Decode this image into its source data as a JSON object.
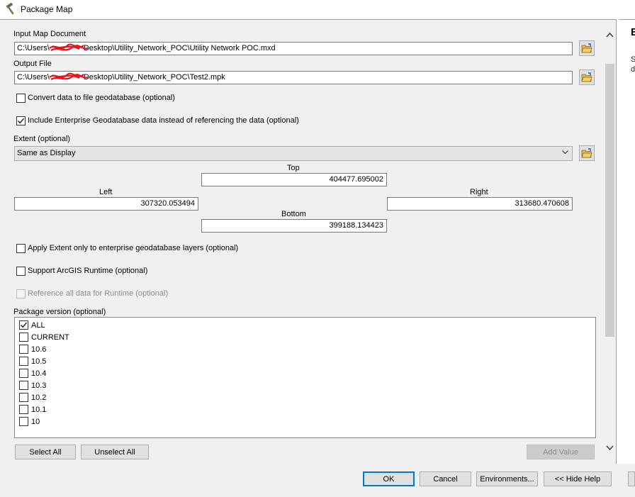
{
  "window": {
    "title": "Package Map"
  },
  "help_panel": {
    "heading": "E",
    "text_lines": [
      "S",
      "d"
    ]
  },
  "input_map": {
    "label": "Input Map Document",
    "value": "C:\\Users\\Desktop\\Utility_Network_POC\\Utility Network POC.mxd",
    "prefix": "C:\\Users\\",
    "suffix": "Desktop\\Utility_Network_POC\\Utility Network POC.mxd"
  },
  "output_file": {
    "label": "Output File",
    "value": "C:\\Users\\Desktop\\Utility_Network_POC\\Test2.mpk",
    "prefix": "C:\\Users\\",
    "suffix": "Desktop\\Utility_Network_POC\\Test2.mpk"
  },
  "convert_gdb": {
    "label": "Convert data to file geodatabase (optional)",
    "checked": false
  },
  "include_enterprise": {
    "label": "Include Enterprise Geodatabase data instead of referencing the data (optional)",
    "checked": true
  },
  "extent": {
    "label": "Extent (optional)",
    "selected": "Same as Display",
    "top_label": "Top",
    "top": "404477.695002",
    "left_label": "Left",
    "left": "307320.053494",
    "right_label": "Right",
    "right": "313680.470608",
    "bottom_label": "Bottom",
    "bottom": "399188.134423"
  },
  "apply_extent": {
    "label": "Apply Extent only to enterprise geodatabase layers (optional)",
    "checked": false
  },
  "support_runtime": {
    "label": "Support ArcGIS Runtime (optional)",
    "checked": false
  },
  "reference_runtime": {
    "label": "Reference all data for Runtime (optional)",
    "checked": false,
    "enabled": false
  },
  "package_version": {
    "label": "Package version (optional)",
    "items": [
      {
        "label": "ALL",
        "checked": true
      },
      {
        "label": "CURRENT",
        "checked": false
      },
      {
        "label": "10.6",
        "checked": false
      },
      {
        "label": "10.5",
        "checked": false
      },
      {
        "label": "10.4",
        "checked": false
      },
      {
        "label": "10.3",
        "checked": false
      },
      {
        "label": "10.2",
        "checked": false
      },
      {
        "label": "10.1",
        "checked": false
      },
      {
        "label": "10",
        "checked": false
      }
    ]
  },
  "list_buttons": {
    "select_all": "Select All",
    "unselect_all": "Unselect All",
    "add_value": "Add Value"
  },
  "footer": {
    "ok": "OK",
    "cancel": "Cancel",
    "environments": "Environments...",
    "hide_help": "<< Hide Help"
  }
}
